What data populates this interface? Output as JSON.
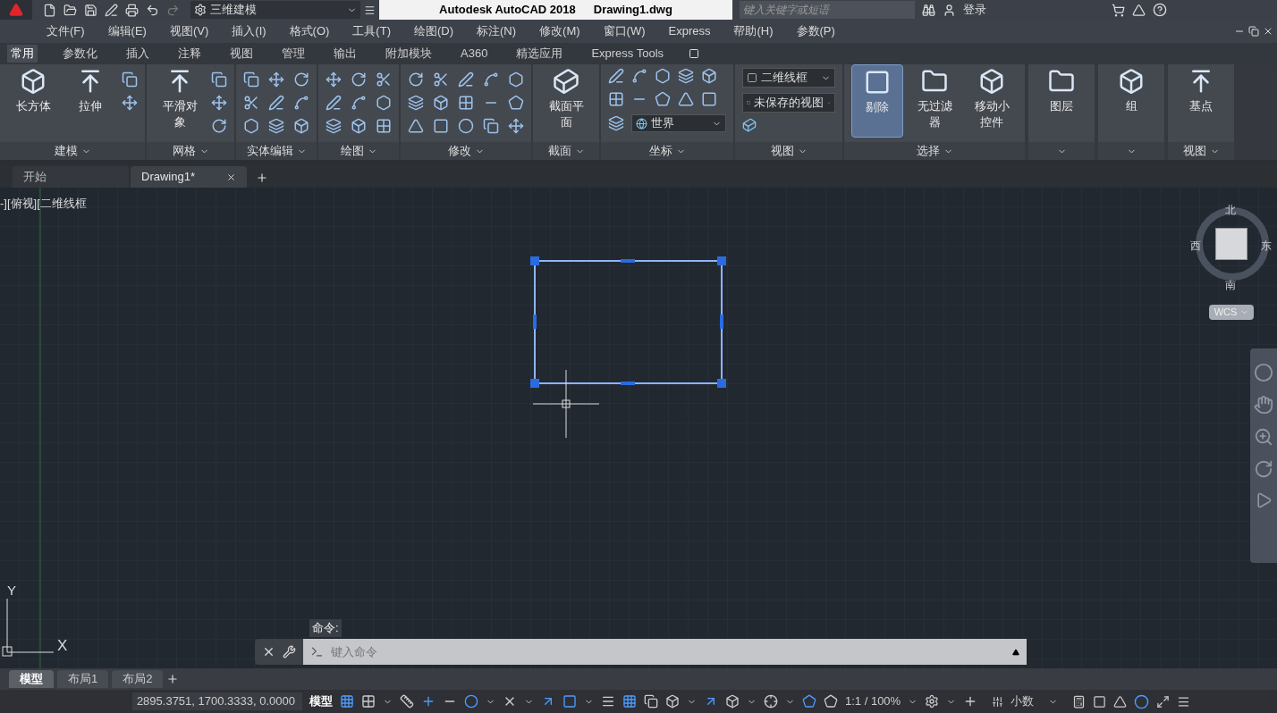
{
  "app": {
    "title": "Autodesk AutoCAD 2018",
    "file": "Drawing1.dwg",
    "workspace": "三维建模",
    "search": {
      "placeholder": "键入关键字或短语"
    },
    "login": "登录"
  },
  "menu": [
    "文件(F)",
    "编辑(E)",
    "视图(V)",
    "插入(I)",
    "格式(O)",
    "工具(T)",
    "绘图(D)",
    "标注(N)",
    "修改(M)",
    "窗口(W)",
    "Express",
    "帮助(H)",
    "参数(P)"
  ],
  "ribbon_tabs": [
    {
      "label": "常用",
      "selected": true
    },
    {
      "label": "参数化",
      "selected": false
    },
    {
      "label": "插入",
      "selected": false
    },
    {
      "label": "注释",
      "selected": false
    },
    {
      "label": "视图",
      "selected": false
    },
    {
      "label": "管理",
      "selected": false
    },
    {
      "label": "输出",
      "selected": false
    },
    {
      "label": "附加模块",
      "selected": false
    },
    {
      "label": "A360",
      "selected": false
    },
    {
      "label": "精选应用",
      "selected": false
    },
    {
      "label": "Express Tools",
      "selected": false
    }
  ],
  "panels": [
    {
      "title": "建模",
      "items": [
        {
          "kind": "large",
          "label": "长方体",
          "selected": false
        },
        {
          "kind": "large",
          "label": "拉伸",
          "selected": false
        },
        {
          "kind": "grid2"
        }
      ]
    },
    {
      "title": "网格",
      "items": [
        {
          "kind": "large",
          "label": "平滑对象",
          "selected": false
        },
        {
          "kind": "grid3"
        }
      ]
    },
    {
      "title": "实体编辑",
      "items": [
        {
          "kind": "grid9"
        }
      ]
    },
    {
      "title": "绘图",
      "items": [
        {
          "kind": "grid9"
        }
      ]
    },
    {
      "title": "修改",
      "items": [
        {
          "kind": "grid15"
        }
      ]
    },
    {
      "title": "截面",
      "items": [
        {
          "kind": "large",
          "label": "截面平面",
          "selected": false
        }
      ]
    },
    {
      "title": "坐标",
      "items": [
        {
          "kind": "coords",
          "value": "世界"
        }
      ]
    },
    {
      "title": "视图",
      "items": [
        {
          "kind": "combos",
          "values": [
            "二维线框",
            "未保存的视图"
          ]
        }
      ]
    },
    {
      "title": "选择",
      "items": [
        {
          "kind": "large",
          "label": "剔除",
          "selected": true
        },
        {
          "kind": "large",
          "label": "无过滤器",
          "selected": false
        },
        {
          "kind": "large",
          "label": "移动小控件",
          "selected": false
        }
      ]
    },
    {
      "items": [
        {
          "kind": "large",
          "label": "图层",
          "selected": false
        }
      ]
    },
    {
      "items": [
        {
          "kind": "large",
          "label": "组",
          "selected": false
        }
      ]
    },
    {
      "title": "视图",
      "items": [
        {
          "kind": "large",
          "label": "基点",
          "selected": false
        }
      ]
    }
  ],
  "doc_tabs": [
    {
      "label": "开始",
      "selected": false
    },
    {
      "label": "Drawing1*",
      "selected": true
    }
  ],
  "viewport_label": "-][俯视][二维线框",
  "viewcube": {
    "north": "北",
    "west": "西",
    "east": "东",
    "south": "南",
    "ucs": "WCS"
  },
  "ucs_axes": {
    "y": "Y",
    "x": "X"
  },
  "command": {
    "label": "命令:",
    "placeholder": "键入命令"
  },
  "layout_tabs": [
    {
      "label": "模型",
      "selected": true
    },
    {
      "label": "布局1",
      "selected": false
    },
    {
      "label": "布局2",
      "selected": false
    }
  ],
  "status": {
    "coordinates": "2895.3751, 1700.3333, 0.0000",
    "space": "模型",
    "scale": "1:1 / 100%",
    "units": "小数"
  }
}
